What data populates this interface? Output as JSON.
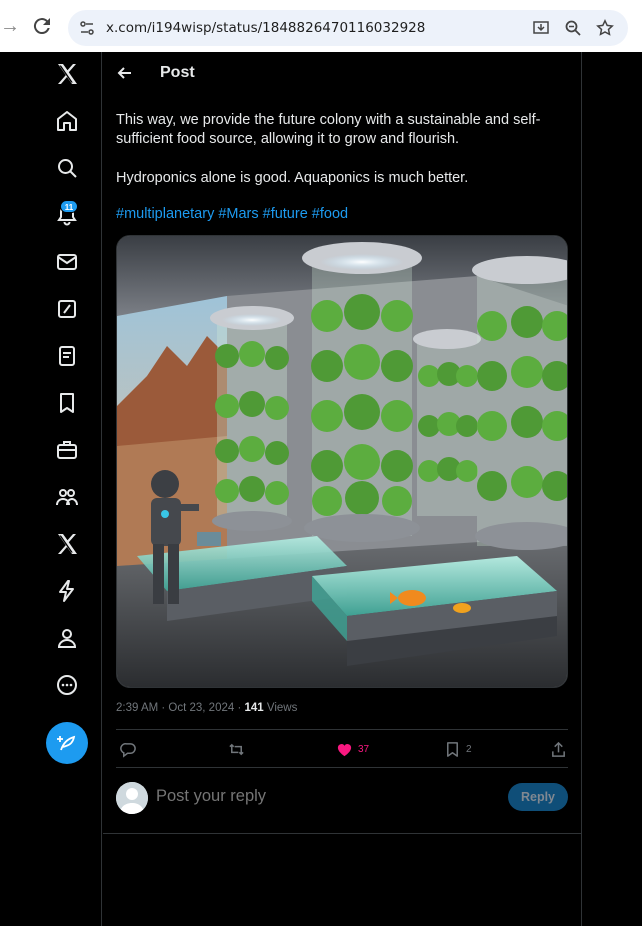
{
  "browser": {
    "url": "x.com/i194wisp/status/1848826470116032928"
  },
  "sidebar": {
    "items": [
      {
        "name": "x-logo-icon"
      },
      {
        "name": "home-icon"
      },
      {
        "name": "explore-icon"
      },
      {
        "name": "notifications-icon"
      },
      {
        "name": "messages-icon"
      },
      {
        "name": "grok-icon"
      },
      {
        "name": "lists-icon"
      },
      {
        "name": "bookmarks-icon"
      },
      {
        "name": "jobs-icon"
      },
      {
        "name": "communities-icon"
      },
      {
        "name": "premium-icon"
      },
      {
        "name": "verified-orgs-icon"
      },
      {
        "name": "profile-icon"
      },
      {
        "name": "more-icon"
      }
    ],
    "notification_count": "11"
  },
  "header": {
    "title": "Post"
  },
  "post": {
    "paragraph1": "This way, we provide the future colony with a sustainable and self-sufficient food source, allowing it to grow and flourish.",
    "paragraph2": "Hydroponics alone is good. Aquaponics is much better.",
    "hashtags": [
      "#multiplanetary",
      "#Mars",
      "#future",
      "#food"
    ],
    "time": "2:39 AM · Oct 23, 2024 · ",
    "views_count": "141",
    "views_label": " Views",
    "likes": "37",
    "bookmarks": "2"
  },
  "reply": {
    "placeholder": "Post your reply",
    "button_label": "Reply"
  },
  "colors": {
    "accent": "#1d9bf0",
    "like": "#f91880",
    "text": "#e7e9ea",
    "muted": "#71767b",
    "border": "#2f3336"
  }
}
